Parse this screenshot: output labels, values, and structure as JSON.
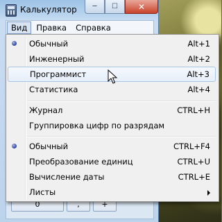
{
  "window": {
    "title": "Калькулятор",
    "caption": {
      "close": "✕",
      "minimize": "─",
      "maximize": "☐"
    }
  },
  "menubar": {
    "items": [
      {
        "label": "Вид",
        "active": true
      },
      {
        "label": "Правка"
      },
      {
        "label": "Справка"
      }
    ]
  },
  "view_menu": {
    "items": [
      {
        "label": "Обычный",
        "accel": "Alt+1",
        "checked": true
      },
      {
        "label": "Инженерный",
        "accel": "Alt+2"
      },
      {
        "label": "Программист",
        "accel": "Alt+3",
        "highlighted": true
      },
      {
        "label": "Статистика",
        "accel": "Alt+4"
      },
      {
        "label": "Журнал",
        "accel": "CTRL+H"
      },
      {
        "label": "Группировка цифр по разрядам",
        "accel": ""
      },
      {
        "label": "Обычный",
        "accel": "CTRL+F4",
        "checked": true
      },
      {
        "label": "Преобразование единиц",
        "accel": "CTRL+U"
      },
      {
        "label": "Вычисление даты",
        "accel": "CTRL+E"
      },
      {
        "label": "Листы",
        "accel": "",
        "submenu": true
      }
    ]
  },
  "keys_partial": [
    "0",
    ",",
    "+"
  ],
  "colors": {
    "checked_bullet": "#2a3f9e",
    "hover_border": "#a8c4e6"
  }
}
